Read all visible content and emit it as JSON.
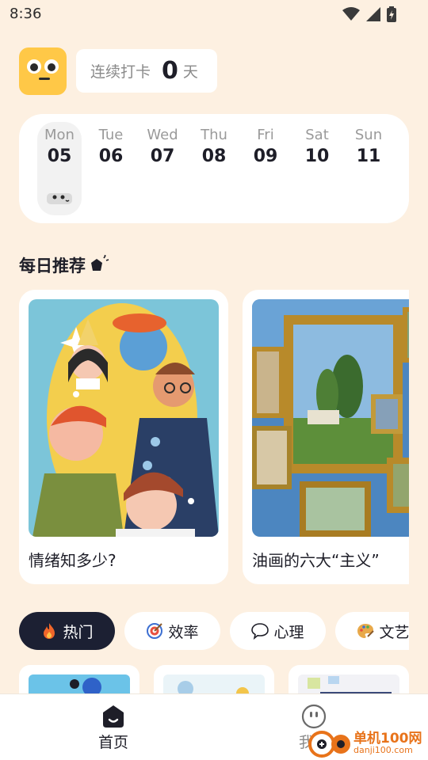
{
  "status_bar": {
    "time": "8:36"
  },
  "streak": {
    "label": "连续打卡",
    "count": "0",
    "unit": "天"
  },
  "week": {
    "days": [
      {
        "name": "Mon",
        "num": "05",
        "selected": true
      },
      {
        "name": "Tue",
        "num": "06",
        "selected": false
      },
      {
        "name": "Wed",
        "num": "07",
        "selected": false
      },
      {
        "name": "Thu",
        "num": "08",
        "selected": false
      },
      {
        "name": "Fri",
        "num": "09",
        "selected": false
      },
      {
        "name": "Sat",
        "num": "10",
        "selected": false
      },
      {
        "name": "Sun",
        "num": "11",
        "selected": false
      }
    ]
  },
  "daily": {
    "title": "每日推荐",
    "cards": [
      {
        "title": "情绪知多少?",
        "image": "people-illustration"
      },
      {
        "title": "油画的六大“主义”",
        "image": "floating-paintings"
      }
    ]
  },
  "chips": [
    {
      "label": "热门",
      "icon": "fire-icon",
      "active": true
    },
    {
      "label": "效率",
      "icon": "target-icon",
      "active": false
    },
    {
      "label": "心理",
      "icon": "speech-bubble-icon",
      "active": false
    },
    {
      "label": "文艺",
      "icon": "palette-icon",
      "active": false
    }
  ],
  "tabs": [
    {
      "label": "首页",
      "icon": "home-icon",
      "active": true
    },
    {
      "label": "我的",
      "icon": "face-icon",
      "active": false
    }
  ],
  "watermark": {
    "line1": "单机100网",
    "line2": "danji100.com"
  },
  "colors": {
    "background": "#FDF0E1",
    "card": "#FFFFFF",
    "accent_yellow": "#FFC847",
    "chip_active": "#1C2033",
    "watermark": "#E8731A"
  }
}
